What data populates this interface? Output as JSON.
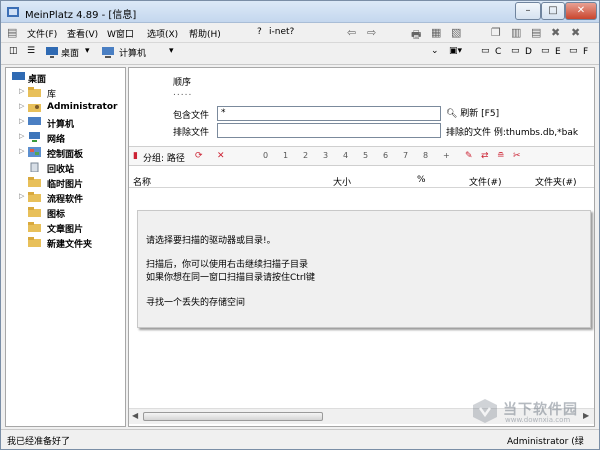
{
  "window": {
    "title": "MeinPlatz 4.89 - [信息]"
  },
  "menu": {
    "items": [
      "文件(F)",
      "查看(V)",
      "W窗口",
      "选项(X)",
      "帮助(H)"
    ],
    "help_mark": "?",
    "inet": "i-net?"
  },
  "toolbar": {
    "desktop_label": "桌面",
    "computer_label": "计算机",
    "drives": [
      "C",
      "D",
      "E",
      "F"
    ]
  },
  "tree": {
    "items": [
      {
        "label": "桌面",
        "bold": true
      },
      {
        "label": "库",
        "bold": true
      },
      {
        "label": "Administrator",
        "bold": true
      },
      {
        "label": "计算机",
        "bold": true
      },
      {
        "label": "网络",
        "bold": true
      },
      {
        "label": "控制面板",
        "bold": true
      },
      {
        "label": "回收站",
        "bold": true
      },
      {
        "label": "临时图片",
        "bold": true
      },
      {
        "label": "流程软件",
        "bold": true
      },
      {
        "label": "图标",
        "bold": true
      },
      {
        "label": "文章图片",
        "bold": true
      },
      {
        "label": "新建文件夹",
        "bold": true
      }
    ]
  },
  "filters": {
    "sort_label": "顺序",
    "sort_dots": ".....",
    "include_label": "包含文件",
    "include_value": "*",
    "exclude_label": "排除文件",
    "exclude_value": "",
    "refresh_label": "刷新 [F5]",
    "exclude_note": "排除的文件 例:thumbs.db,*bak"
  },
  "options": {
    "group_label": "分组: 路径",
    "levels": [
      "0",
      "1",
      "2",
      "3",
      "4",
      "5",
      "6",
      "7",
      "8",
      "+"
    ]
  },
  "columns": [
    "名称",
    "大小",
    "%",
    "文件(#)",
    "文件夹(#)"
  ],
  "message": {
    "line1": "请选择要扫描的驱动器或目录!。",
    "line2": "扫描后，你可以使用右击继续扫描子目录",
    "line3": "如果你想在同一窗口扫描目录请按住Ctrl键",
    "line4": "寻找一个丢失的存储空间"
  },
  "status": {
    "left": "我已经准备好了",
    "right": "Administrator (绿"
  },
  "watermark": {
    "text": "当下软件园",
    "sub": "www.downxia.com"
  }
}
